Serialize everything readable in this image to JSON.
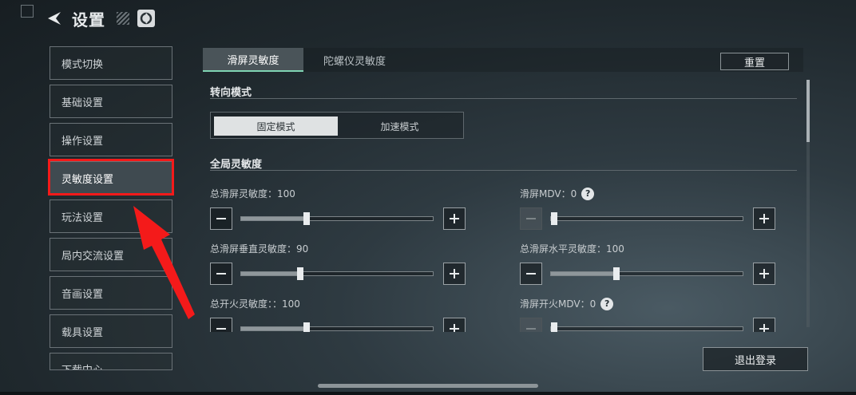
{
  "header": {
    "title": "设置"
  },
  "sidebar": {
    "items": [
      {
        "label": "模式切换"
      },
      {
        "label": "基础设置"
      },
      {
        "label": "操作设置"
      },
      {
        "label": "灵敏度设置"
      },
      {
        "label": "玩法设置"
      },
      {
        "label": "局内交流设置"
      },
      {
        "label": "音画设置"
      },
      {
        "label": "载具设置"
      },
      {
        "label": "下载中心"
      }
    ],
    "active_index": 3
  },
  "tabs": [
    {
      "label": "滑屏灵敏度",
      "active": true
    },
    {
      "label": "陀螺仪灵敏度",
      "active": false
    }
  ],
  "reset_label": "重置",
  "turn_mode": {
    "title": "转向模式",
    "options": [
      {
        "label": "固定模式",
        "active": true
      },
      {
        "label": "加速模式",
        "active": false
      }
    ]
  },
  "global_sensitivity": {
    "title": "全局灵敏度",
    "sliders": [
      {
        "label": "总滑屏灵敏度：100",
        "level": 0.34,
        "min_disabled": false
      },
      {
        "label": "滑屏MDV：0",
        "level": 0.0,
        "min_disabled": true,
        "help": "?"
      },
      {
        "label": "总滑屏垂直灵敏度：90",
        "level": 0.31,
        "min_disabled": false
      },
      {
        "label": "总滑屏水平灵敏度：100",
        "level": 0.34,
        "min_disabled": false
      },
      {
        "label": "总开火灵敏度：：100",
        "level": 0.34,
        "min_disabled": false
      },
      {
        "label": "滑屏开火MDV：0",
        "level": 0.0,
        "min_disabled": true,
        "help": "?"
      }
    ]
  },
  "logout_label": "退出登录",
  "colors": {
    "highlight": "#f41a1a",
    "tab_accent": "#7fd3b2"
  }
}
